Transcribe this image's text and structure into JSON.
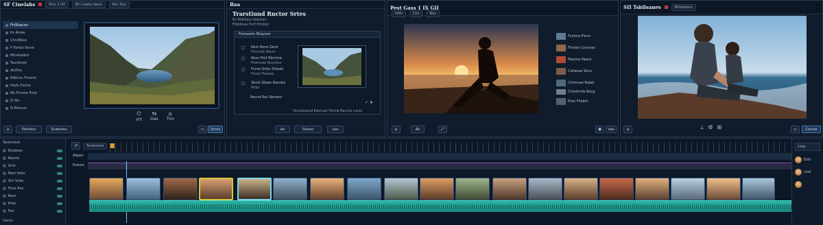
{
  "panels": {
    "media": {
      "title": "SF Cinelabs",
      "tabs": [
        "Ploo 3 LH",
        "Bh Lrasbu Geso",
        "Bor Zoo"
      ],
      "tree": [
        "Fh/Rsacon",
        "Ko Anew",
        "Chn/Rbsa",
        "P Farlao Ilorse",
        "Mhnkoebm",
        "Toorbirels",
        "Ak/Poo",
        "Riblnnc Fnrerer",
        "Ha/lo Foorm",
        "Ms Flrnme Foilo",
        "Jh No",
        "N Rhbuso"
      ],
      "controls": [
        "Vrt",
        "Gas",
        "Tlro"
      ],
      "buttons": [
        "Pinhbno",
        "SLdoomo",
        "Ocroo"
      ]
    },
    "edit": {
      "title": "Trarstiund Rnctor Srtes",
      "subtitle": "Baa",
      "lines": [
        "Ez Rhbdaur Goohan",
        "Fhblboas Forf Prmbor"
      ],
      "inner_tab": "Fronseets Rhayoro",
      "options": [
        {
          "title": "Kbm Rone Gerd",
          "sub": "Fhsnnbt Rocm"
        },
        {
          "title": "Ress Hmf Rbmtne",
          "sub": "Ptamnee Roscbos"
        },
        {
          "title": "Fsnre Onbu Shbolo",
          "sub": "Flneo Fbaseb"
        },
        {
          "title": "Sbnls Slbwo Ransbe",
          "sub": "Rhbs"
        }
      ],
      "apply": "Recnd Roc Reveno",
      "status": "Oucssloond Esenuer Fonnb Eacrne Lorss",
      "buttons": [
        "Ao",
        "Slnoso",
        "Loo"
      ]
    },
    "preview": {
      "title": "Pest Gass 1 IX GII",
      "tabs": [
        "Pdfo",
        "Chc",
        "Boc"
      ],
      "list": [
        "Fsnhna Flnnn",
        "Flnnbn Cocnoes",
        "Pbacoa Paeco",
        "Cwfeose Sbnn",
        "Ctnmnoe Robel",
        "Ctmohrrfe Bocg",
        "Proo Fhebm"
      ],
      "buttons": [
        "Ak",
        "Vao"
      ]
    },
    "viewer": {
      "title": "SII Tsbllsanes",
      "tag": "Btlbahiocs",
      "buttons": [
        "Corcse"
      ]
    }
  },
  "timeline": {
    "label": "Teclemedi",
    "tracks": [
      "Koubees",
      "Rearte",
      "Snlo",
      "Rbol Vebo",
      "Sirt Scbe",
      "Fone Ros",
      "Ress",
      "Erbe",
      "Fen"
    ],
    "track_heads": [
      "Adpen",
      "Eoesre"
    ],
    "right": [
      "Cola",
      "Eslo",
      "Lhst"
    ],
    "footer": "Oamn"
  }
}
